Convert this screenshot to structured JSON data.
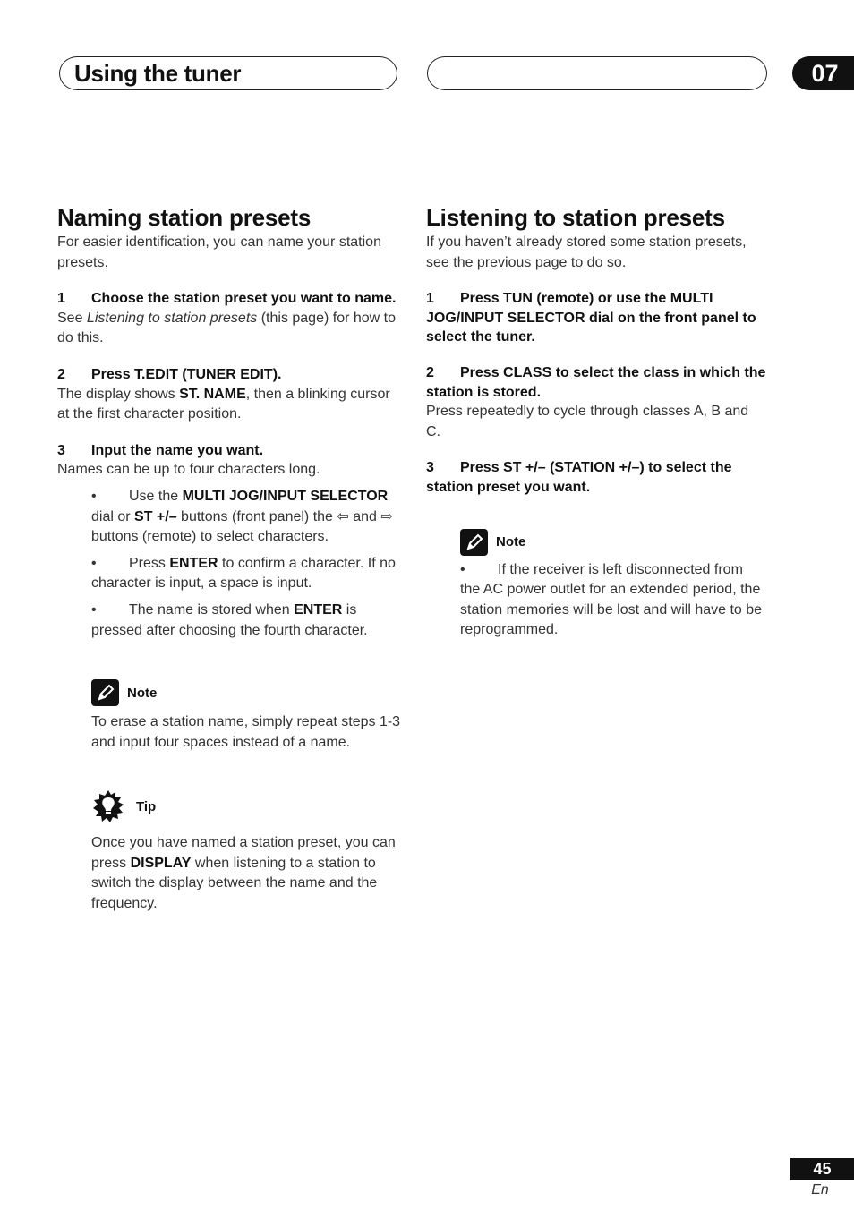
{
  "header": {
    "section_title": "Using the tuner",
    "right_pill_text": "",
    "chapter_number": "07"
  },
  "left": {
    "title": "Naming station presets",
    "intro": "For easier identification, you can name your station presets.",
    "steps": [
      {
        "num": "1",
        "title": "Choose the station preset you want to name.",
        "body_pre": "See ",
        "body_italic": "Listening to station presets",
        "body_post": " (this page) for how to do this."
      },
      {
        "num": "2",
        "title": "Press T.EDIT (TUNER EDIT).",
        "body_pre": "The display shows ",
        "body_bold": "ST. NAME",
        "body_post": ", then a blinking cursor at the first character position."
      },
      {
        "num": "3",
        "title": "Input the name you want.",
        "body": "Names can be up to four characters long."
      }
    ],
    "bullets": [
      {
        "bullet": "•",
        "t1": "Use the ",
        "b1": "MULTI JOG/INPUT SELECTOR",
        "t2": " dial or ",
        "b2": "ST +/–",
        "t3": " buttons (front panel)  the ",
        "arrow_left": "⇦",
        "t4": " and ",
        "arrow_right": "⇨",
        "t5": " buttons (remote) to select characters."
      },
      {
        "bullet": "•",
        "t1": "Press ",
        "b1": "ENTER",
        "t2": " to confirm a character. If no character is input, a space is input."
      },
      {
        "bullet": "•",
        "t1": "The name is stored when ",
        "b1": "ENTER",
        "t2": " is pressed after choosing the fourth character."
      }
    ],
    "note": {
      "label": "Note",
      "icon": "pencil-icon",
      "text": "To erase a station name, simply repeat steps 1-3 and input four spaces instead of a name."
    },
    "tip": {
      "label": "Tip",
      "icon": "lightbulb-icon",
      "t1": "Once you have named a station preset, you can press ",
      "b1": "DISPLAY",
      "t2": " when listening to a station to switch the display between the name and the frequency."
    }
  },
  "right": {
    "title": "Listening to station presets",
    "intro": "If you haven’t already stored some station presets, see the previous page to do so.",
    "steps": [
      {
        "num": "1",
        "title": "Press TUN (remote) or use the MULTI JOG/INPUT SELECTOR dial on the front panel to select the tuner."
      },
      {
        "num": "2",
        "title": "Press CLASS to select the class in which the station is stored.",
        "body": "Press repeatedly to cycle through classes A, B and C."
      },
      {
        "num": "3",
        "title": "Press ST +/– (STATION +/–) to select the station preset you want."
      }
    ],
    "note": {
      "label": "Note",
      "icon": "pencil-icon",
      "bullet": "•",
      "text": "If the receiver is left disconnected from the AC power outlet for an extended period, the station memories will be lost and will have to be reprogrammed."
    }
  },
  "footer": {
    "page_number": "45",
    "language": "En"
  }
}
